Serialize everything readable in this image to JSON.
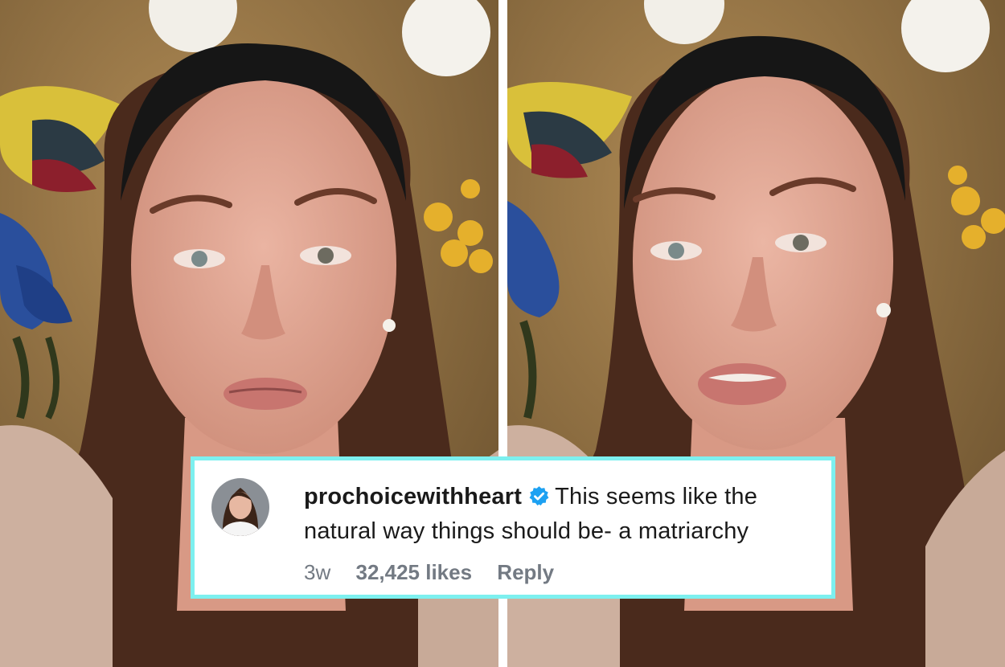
{
  "photo": {
    "description_icons": [
      "woman-photo-left",
      "woman-photo-right"
    ],
    "colors": {
      "wallpaper": "#8a6a3c",
      "skin": "#e2a795",
      "hair": "#4a2a1c",
      "headband": "#161616",
      "frame": "#7df0ef"
    }
  },
  "comment": {
    "username": "prochoicewithheart",
    "text": "This seems like the natural way things should be- a matriarchy",
    "time": "3w",
    "likes": "32,425 likes",
    "reply_label": "Reply",
    "avatar_icon": "profile-avatar",
    "verified_icon": "verified-badge-icon"
  }
}
